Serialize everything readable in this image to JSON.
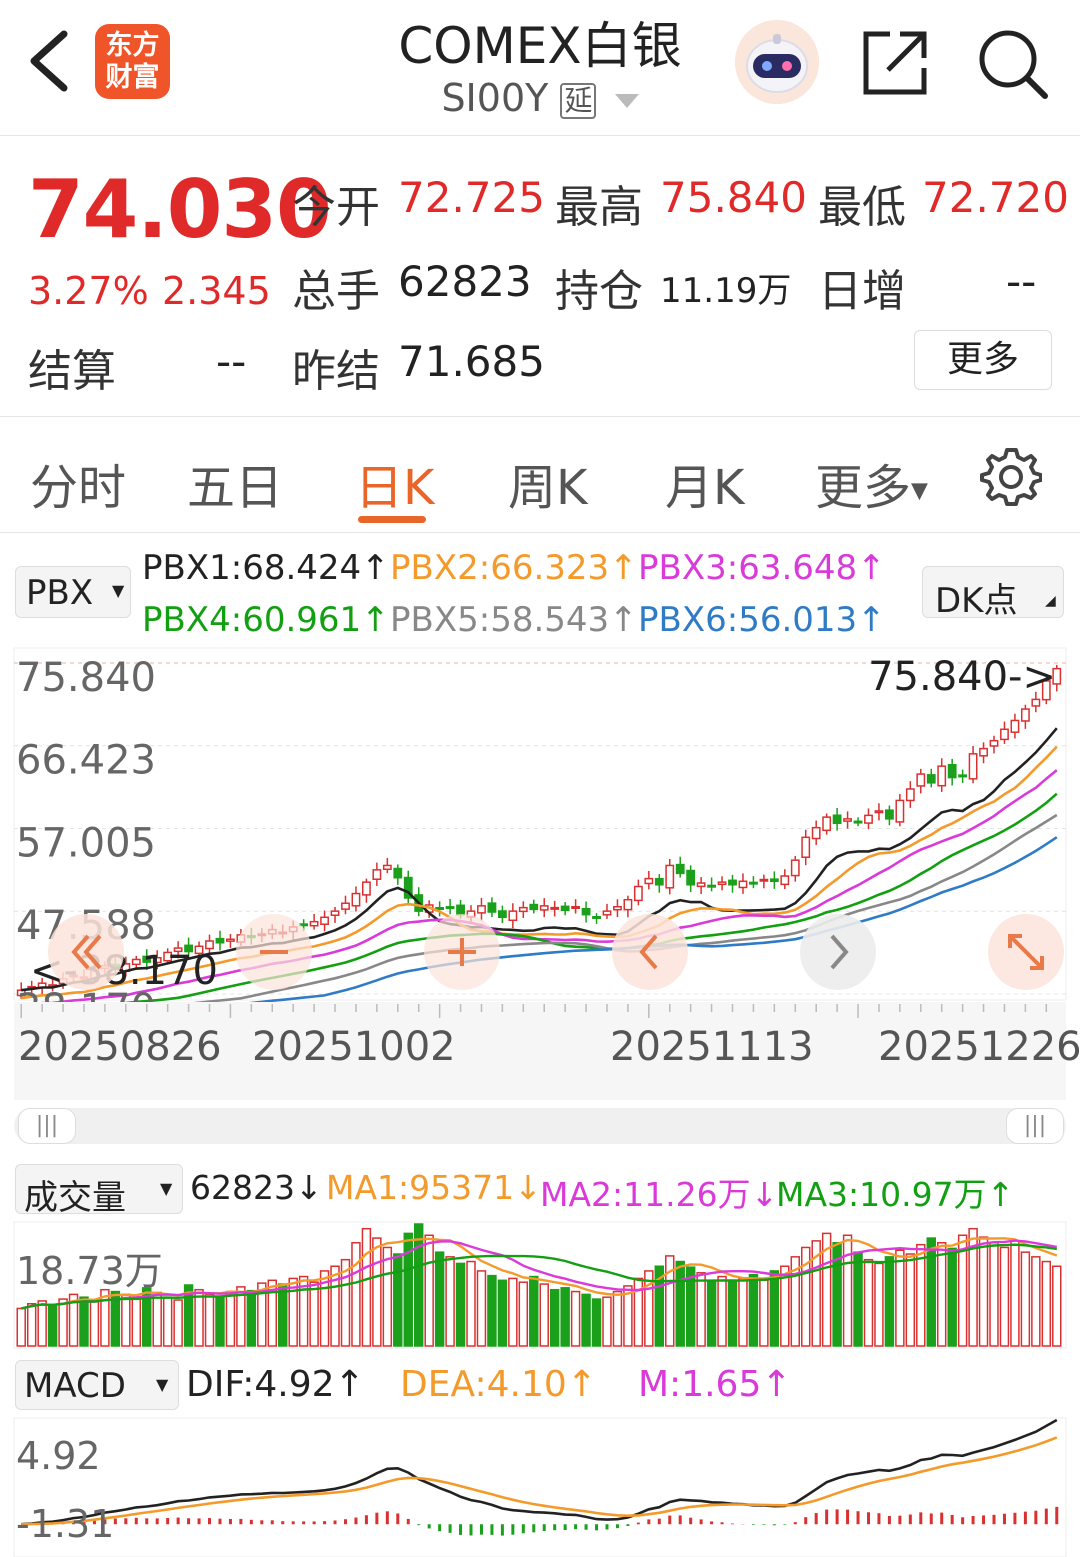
{
  "header": {
    "logo_text": "东方财富",
    "title": "COMEX白银",
    "code": "SI00Y",
    "delay_badge": "延",
    "icons": [
      "back-icon",
      "robot-avatar-icon",
      "share-icon",
      "search-icon"
    ]
  },
  "quote": {
    "price": "74.030",
    "change_pct": "3.27%",
    "change_abs": "2.345",
    "settle_label": "结算",
    "settle_value": "--",
    "open_label": "今开",
    "open_value": "72.725",
    "high_label": "最高",
    "high_value": "75.840",
    "low_label": "最低",
    "low_value": "72.720",
    "volume_label": "总手",
    "volume_value": "62823",
    "oi_label": "持仓",
    "oi_value": "11.19万",
    "daily_inc_label": "日增",
    "daily_inc_value": "--",
    "prev_settle_label": "昨结",
    "prev_settle_value": "71.685",
    "more_label": "更多"
  },
  "tabs": {
    "items": [
      "分时",
      "五日",
      "日K",
      "周K",
      "月K",
      "更多"
    ],
    "active": "日K"
  },
  "main_indicator": {
    "selector": "PBX",
    "dk_label": "DK点",
    "values": [
      {
        "text": "PBX1:68.424↑",
        "color": "#222222"
      },
      {
        "text": "PBX2:66.323↑",
        "color": "#f39a2b"
      },
      {
        "text": "PBX3:63.648↑",
        "color": "#d93ad9"
      },
      {
        "text": "PBX4:60.961↑",
        "color": "#12a012"
      },
      {
        "text": "PBX5:58.543↑",
        "color": "#888888"
      },
      {
        "text": "PBX6:56.013↑",
        "color": "#2f7bc6"
      }
    ]
  },
  "volume_indicator": {
    "selector": "成交量",
    "v": "62823↓",
    "ma1": "MA1:95371↓",
    "ma2": "MA2:11.26万↓",
    "ma3": "MA3:10.97万↑",
    "axis_top": "18.73万"
  },
  "macd_indicator": {
    "selector": "MACD",
    "dif": "DIF:4.92↑",
    "dea": "DEA:4.10↑",
    "m": "M:1.65↑",
    "axis_top": "4.92",
    "axis_bottom": "-1.31"
  },
  "chart_data": [
    {
      "type": "candlestick",
      "title": "",
      "y_tick_labels": [
        "75.840",
        "66.423",
        "57.005",
        "47.588",
        "38.170"
      ],
      "ylim": [
        38.17,
        75.84
      ],
      "x_tick_labels": [
        "20250826",
        "20251002",
        "20251113",
        "20251226"
      ],
      "max_annotation": "75.840->",
      "min_annotation": "<-38.170",
      "series_names": [
        "PBX1",
        "PBX2",
        "PBX3",
        "PBX4",
        "PBX5",
        "PBX6"
      ],
      "close": [
        38.6,
        39.0,
        39.4,
        39.2,
        39.9,
        40.3,
        40.1,
        40.8,
        41.4,
        41.1,
        41.6,
        42.1,
        41.8,
        42.3,
        42.9,
        43.4,
        43.0,
        43.6,
        44.2,
        44.0,
        44.4,
        44.9,
        44.6,
        45.0,
        45.5,
        45.2,
        45.8,
        46.1,
        46.4,
        46.9,
        47.6,
        48.5,
        49.6,
        50.9,
        52.3,
        52.8,
        51.4,
        49.1,
        47.6,
        48.3,
        47.9,
        48.0,
        47.2,
        47.6,
        48.2,
        47.5,
        46.9,
        47.6,
        48.0,
        47.8,
        48.2,
        48.0,
        47.7,
        48.1,
        47.2,
        46.9,
        47.6,
        48.1,
        48.9,
        50.4,
        51.3,
        50.6,
        52.8,
        51.9,
        50.6,
        50.8,
        50.4,
        50.9,
        50.6,
        51.0,
        50.7,
        51.2,
        51.0,
        51.6,
        53.4,
        56.0,
        57.1,
        58.3,
        57.6,
        58.1,
        57.8,
        58.5,
        59.0,
        58.1,
        60.2,
        61.5,
        63.2,
        62.2,
        64.1,
        62.8,
        62.9,
        65.5,
        66.1,
        67.0,
        68.3,
        69.3,
        70.6,
        71.7,
        73.8,
        75.2
      ],
      "pbx1_end": 68.424,
      "pbx2_end": 66.323,
      "pbx3_end": 63.648,
      "pbx4_end": 60.961,
      "pbx5_end": 58.543,
      "pbx6_end": 56.013
    },
    {
      "type": "bar",
      "title": "",
      "label": "成交量",
      "ylim": [
        0,
        187300
      ],
      "axis_top_label": "18.73万",
      "volumes": [
        40,
        45,
        48,
        42,
        50,
        55,
        52,
        47,
        60,
        58,
        55,
        50,
        62,
        57,
        52,
        49,
        65,
        60,
        55,
        52,
        58,
        63,
        59,
        67,
        70,
        66,
        72,
        74,
        68,
        80,
        85,
        92,
        110,
        125,
        115,
        105,
        98,
        120,
        130,
        118,
        100,
        95,
        88,
        90,
        80,
        75,
        70,
        72,
        68,
        74,
        66,
        60,
        62,
        58,
        55,
        50,
        52,
        58,
        64,
        72,
        80,
        85,
        96,
        90,
        84,
        78,
        70,
        74,
        68,
        72,
        76,
        70,
        80,
        85,
        95,
        105,
        112,
        120,
        110,
        118,
        100,
        92,
        88,
        95,
        102,
        98,
        108,
        115,
        110,
        104,
        118,
        125,
        116,
        110,
        105,
        112,
        100,
        95,
        90,
        85
      ],
      "ma1_end": 95371,
      "ma2_end": 112600,
      "ma3_end": 109700
    },
    {
      "type": "line",
      "title": "",
      "label": "MACD",
      "ylim": [
        -1.31,
        4.92
      ],
      "axis_top_label": "4.92",
      "axis_bottom_label": "-1.31",
      "dif_end": 4.92,
      "dea_end": 4.1,
      "m_end": 1.65
    }
  ],
  "colors": {
    "up": "#d93030",
    "down": "#1aa01a",
    "accent": "#e8662a",
    "pbx": [
      "#222222",
      "#f39a2b",
      "#d93ad9",
      "#12a012",
      "#888888",
      "#2f7bc6"
    ]
  }
}
